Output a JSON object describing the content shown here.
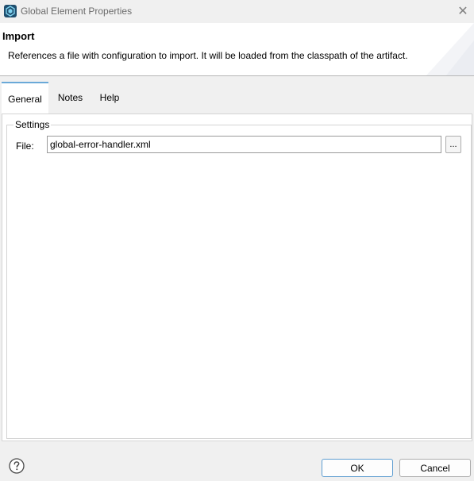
{
  "window": {
    "title": "Global Element Properties",
    "close_glyph": "✕"
  },
  "header": {
    "title": "Import",
    "description": "References a file with configuration to import. It will be loaded from the classpath of the artifact."
  },
  "tabs": [
    {
      "label": "General",
      "active": true
    },
    {
      "label": "Notes",
      "active": false
    },
    {
      "label": "Help",
      "active": false
    }
  ],
  "settings": {
    "legend": "Settings",
    "file_label": "File:",
    "file_value": "global-error-handler.xml",
    "browse_label": "..."
  },
  "footer": {
    "help_icon": "question-circle-icon",
    "ok_label": "OK",
    "cancel_label": "Cancel"
  },
  "colors": {
    "accent": "#6aa9d8",
    "app_icon": "#1f4e6e"
  }
}
